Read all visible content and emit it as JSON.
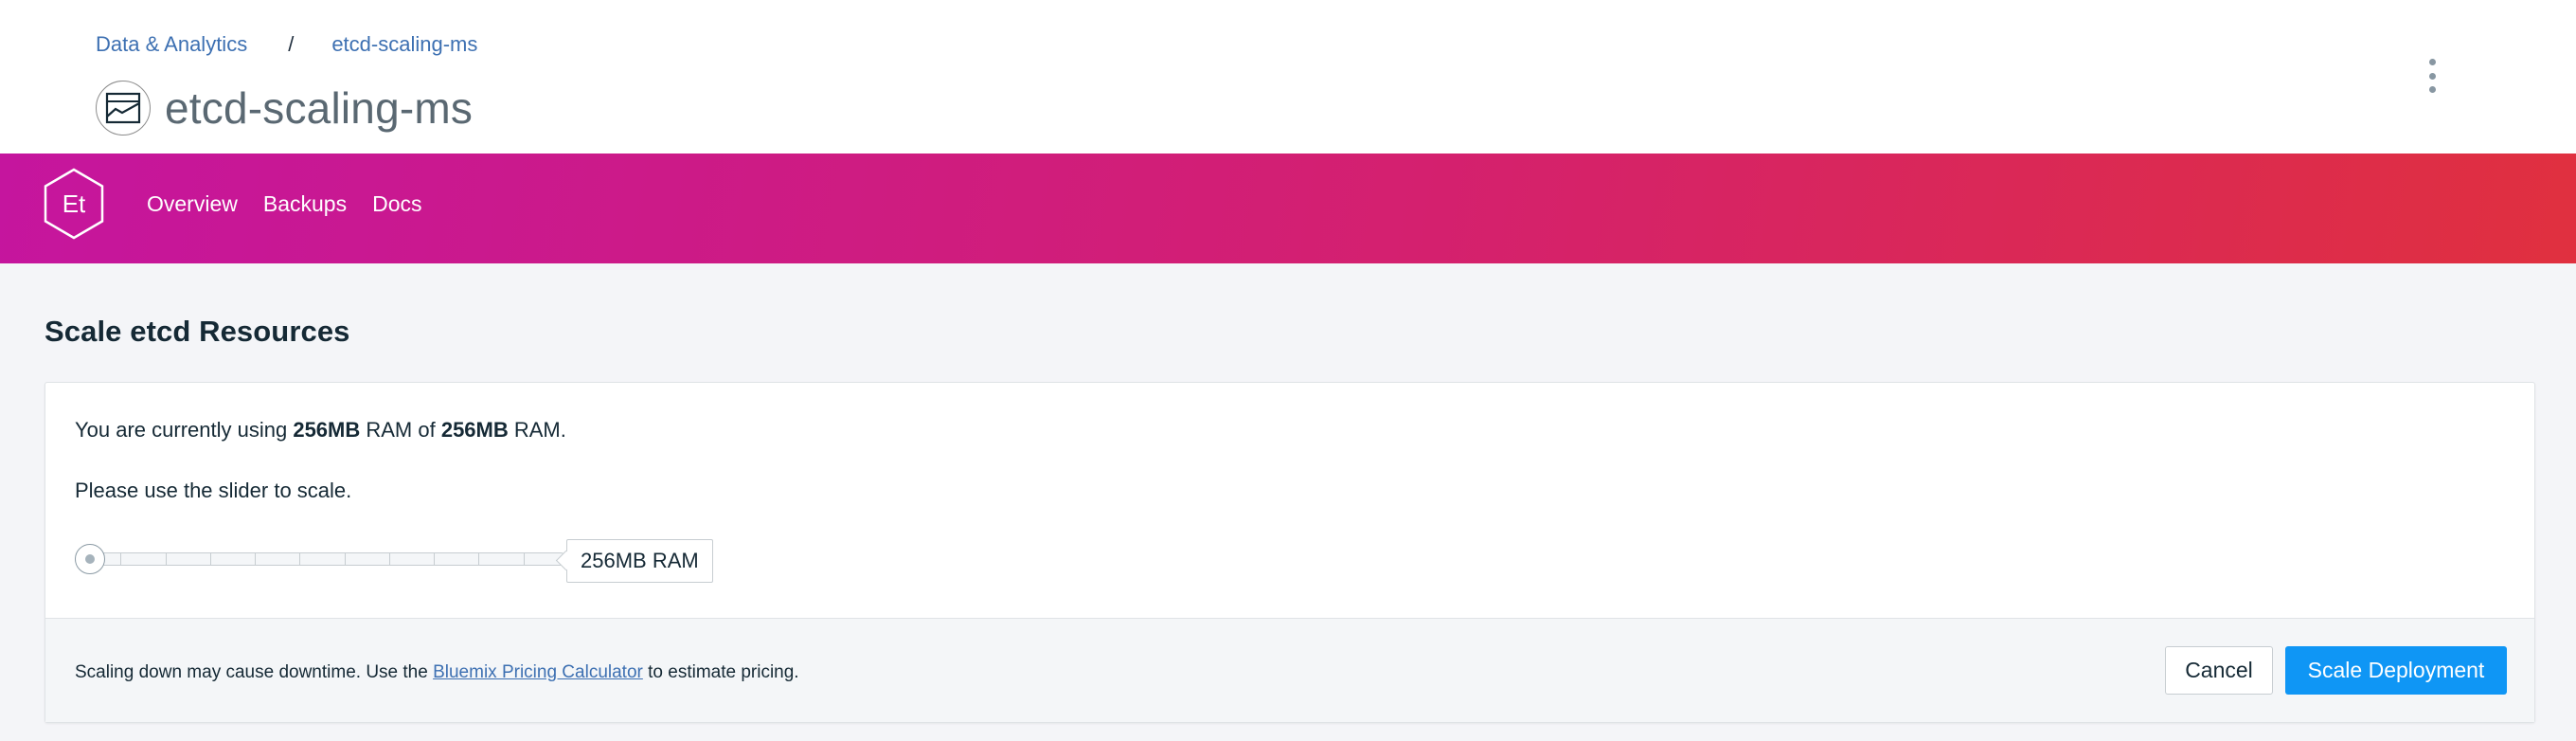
{
  "breadcrumb": {
    "parent": "Data & Analytics",
    "separator": "/",
    "current": "etcd-scaling-ms"
  },
  "header": {
    "title": "etcd-scaling-ms",
    "service_icon": "line-chart-icon",
    "menu_icon": "overflow-menu-vertical-icon"
  },
  "brand": {
    "logo_text": "Et",
    "gradient_start": "#c5159e",
    "gradient_end": "#e0303f",
    "nav": [
      {
        "label": "Overview"
      },
      {
        "label": "Backups"
      },
      {
        "label": "Docs"
      }
    ]
  },
  "scale": {
    "section_title": "Scale etcd Resources",
    "usage_prefix": "You are currently using ",
    "usage_current": "256MB",
    "usage_middle": " RAM of ",
    "usage_max": "256MB",
    "usage_suffix": " RAM.",
    "hint": "Please use the slider to scale.",
    "slider_value_fraction": 0,
    "slider_tag": "256MB RAM"
  },
  "footer": {
    "note_prefix": "Scaling down may cause downtime. Use the ",
    "link_text": "Bluemix Pricing Calculator",
    "note_suffix": " to estimate pricing.",
    "cancel_label": "Cancel",
    "submit_label": "Scale Deployment",
    "accent_color": "#0f96f5"
  }
}
